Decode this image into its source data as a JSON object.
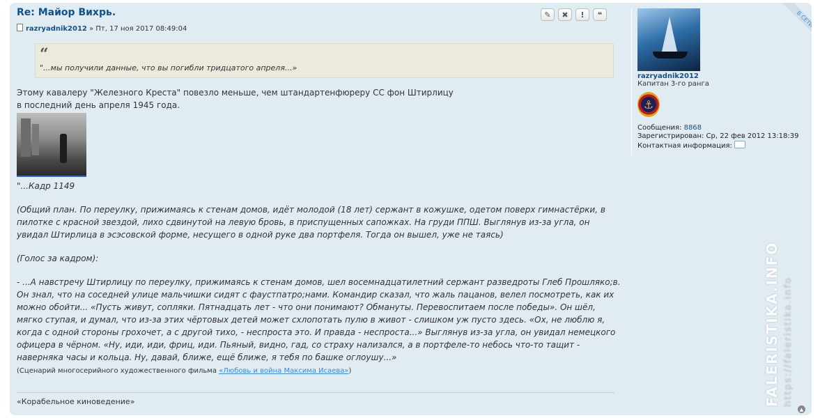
{
  "post": {
    "title": "Re: Майор Вихрь.",
    "author": "razryadnik2012",
    "date": "» Пт, 17 ноя 2017 08:49:04",
    "buttons": [
      {
        "name": "edit",
        "icon": "pencil-icon",
        "glyph": "✎"
      },
      {
        "name": "delete",
        "icon": "close-icon",
        "glyph": "✖"
      },
      {
        "name": "report",
        "icon": "warning-icon",
        "glyph": "!"
      },
      {
        "name": "quote",
        "icon": "quote-icon",
        "glyph": "❝"
      }
    ],
    "quote": {
      "mark": "“",
      "text": "\"...мы получили данные, что вы погибли тридцатого апреля...»"
    },
    "body": {
      "line1": "Этому кавалеру \"Железного Креста\" повезло меньше, чем штандартенфюреру СС фон Штирлицу",
      "line2": "в последний день апреля 1945 года.",
      "caption": "\"...Кадр 1149",
      "paragraph1": "(Общий план. По переулку, прижимаясь к стенам домов, идёт молодой (18 лет) сержант в кожушке, одетом поверх гимнастёрки, в пилотке с красной звездой, лихо сдвинутой на левую бровь, в приспущенных сапожках. На груди ППШ. Выглянув из-за угла, он увидал Штирлица в эсэсовской форме, несущего в одной руке два портфеля. Тогда он вышел, уже не таясь)",
      "paragraph2": "(Голос за кадром):",
      "paragraph3": "- ...А навстречу Штирлицу по переулку, прижимаясь к стенам домов, шел восемнадцатилетний сержант разведроты Глеб Прошляко;в. Он знал, что на соседней улице мальчишки сидят с фаустпатро;нами. Командир сказал, что жаль пацанов, велел посмотреть, как их можно обойти... «Пусть живут, сопляки. Пятнадцать лет - что они понимают? Обмануты. Перевоспитаем после победы». Он шёл, мягко ступая, и думал, что из-за этих чёртовых детей может схлопотать пулю в живот - слишком уж пусто здесь. «Ох, не люблю я, когда с одной стороны грохочет, а с другой тихо, - неспроста это. И правда - неспроста...» Выглянув из-за угла, он увидал немецкого офицера в чёрном. «Ну, иди, иди, фриц, иди. Пьяный, видно, гад, со страху нализался, а в портфеле-то небось что-то тащит - наверняка часы и кольца. Ну, давай, ближе, ещё ближе, я тебя по башке оглоушу...»",
      "source_prefix": "(Сценарий многосерийного художественного фильма ",
      "source_link": "«Любовь и война Максима Исаева»",
      "source_suffix": ")"
    },
    "signature": "«Корабельное киноведение»"
  },
  "profile": {
    "status": "В СЕТИ",
    "username": "razryadnik2012",
    "rank": "Капитан 3-го ранга",
    "messages_label": "Сообщения:",
    "messages_value": "8868",
    "registered_label": "Зарегистрирован:",
    "registered_value": "Ср, 22 фев 2012 13:18:39",
    "contact_label": "Контактная информация:"
  },
  "watermark": {
    "brand": "FALERISTIKA.INFO",
    "url": "https://faleristika.info"
  },
  "colors": {
    "panel_bg": "#e1ebf2",
    "link": "#105289",
    "quote_bg": "#ebeadd"
  }
}
